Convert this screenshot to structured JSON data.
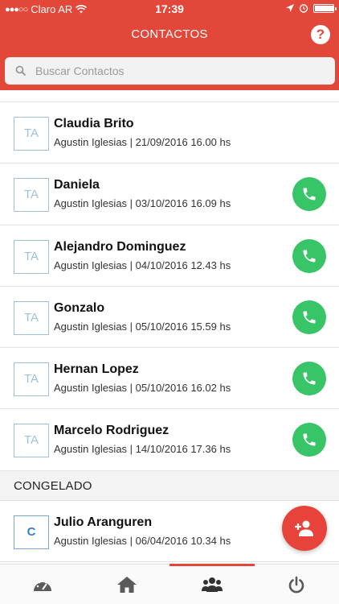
{
  "status_bar": {
    "carrier": "Claro AR",
    "time": "17:39",
    "signal_dots": "●●●○○"
  },
  "header": {
    "title": "CONTACTOS",
    "help_label": "?",
    "bg_color": "#e2473a"
  },
  "search": {
    "placeholder": "Buscar Contactos",
    "value": ""
  },
  "contacts": [
    {
      "initials": "TA",
      "name": "Claudia Brito",
      "meta": "Agustin Iglesias | 21/09/2016 16.00 hs",
      "call": false
    },
    {
      "initials": "TA",
      "name": "Daniela",
      "meta": "Agustin Iglesias | 03/10/2016 16.09 hs",
      "call": true
    },
    {
      "initials": "TA",
      "name": "Alejandro Dominguez",
      "meta": "Agustin Iglesias | 04/10/2016 12.43 hs",
      "call": true
    },
    {
      "initials": "TA",
      "name": "Gonzalo",
      "meta": "Agustin Iglesias | 05/10/2016 15.59 hs",
      "call": true
    },
    {
      "initials": "TA",
      "name": "Hernan Lopez",
      "meta": "Agustin Iglesias | 05/10/2016 16.02 hs",
      "call": true
    },
    {
      "initials": "TA",
      "name": "Marcelo Rodriguez",
      "meta": "Agustin Iglesias | 14/10/2016 17.36 hs",
      "call": true
    }
  ],
  "frozen_section": {
    "title": "CONGELADO",
    "contacts": [
      {
        "initials": "C",
        "name": "Julio Aranguren",
        "meta": "Agustin Iglesias | 06/04/2016 10.34 hs"
      }
    ]
  },
  "fab": {
    "icon": "add-person-icon"
  },
  "tabbar": {
    "active_index": 2,
    "tabs": [
      {
        "icon": "dashboard-icon"
      },
      {
        "icon": "home-icon"
      },
      {
        "icon": "group-icon"
      },
      {
        "icon": "power-icon"
      }
    ]
  },
  "colors": {
    "accent": "#e2473a",
    "call_green": "#37c567",
    "avatar_border": "#9fc0dc"
  }
}
